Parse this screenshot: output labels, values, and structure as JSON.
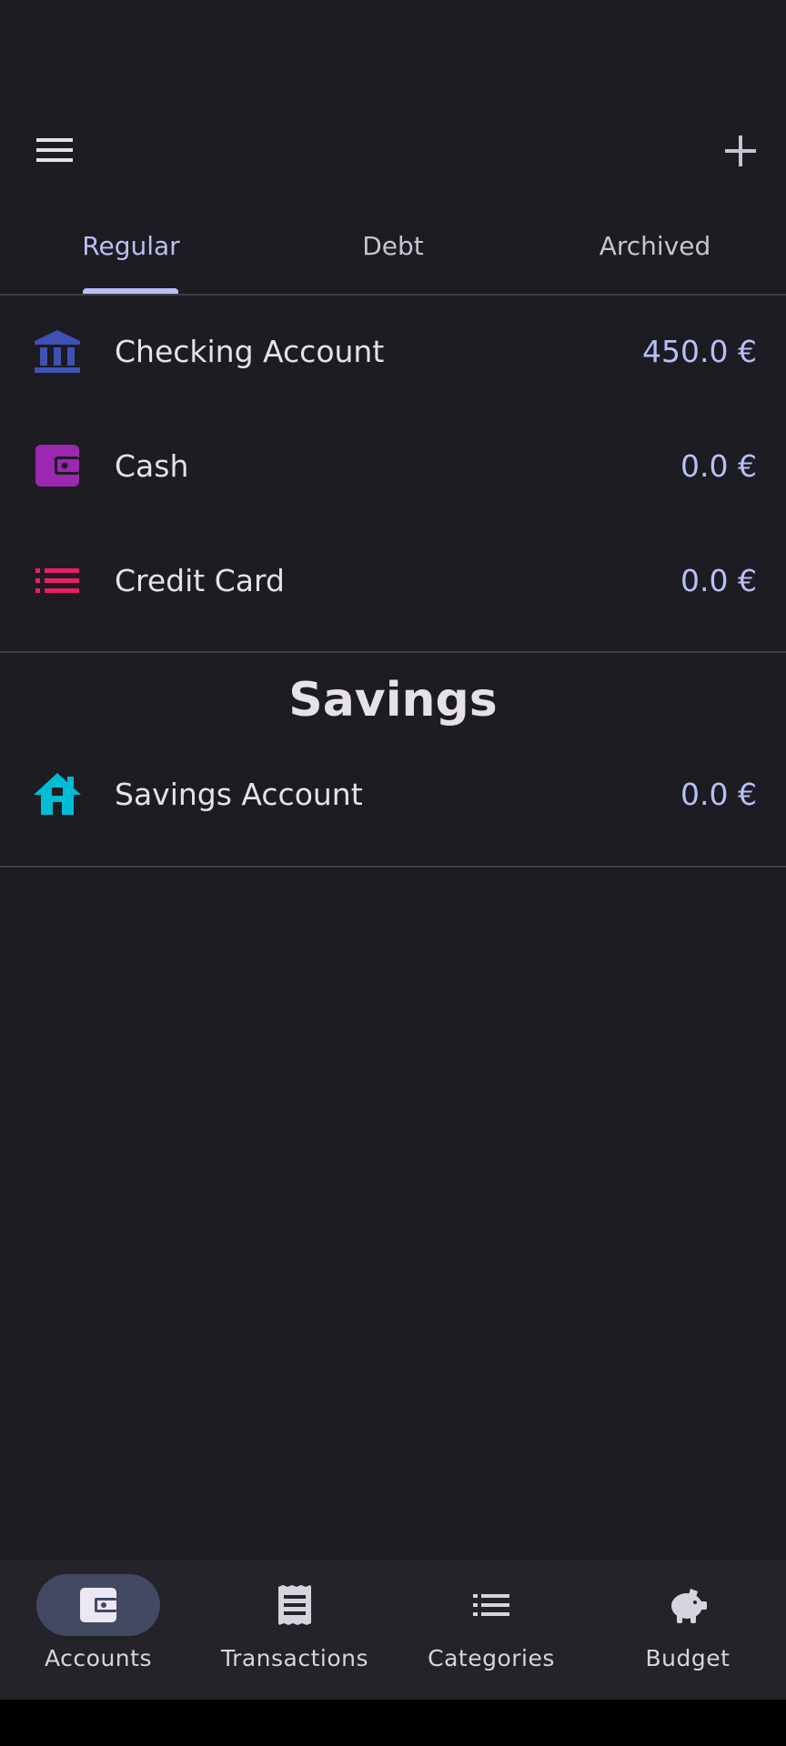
{
  "toolbar": {
    "menu_icon": "menu-icon",
    "add_icon": "plus-icon"
  },
  "tabs": [
    {
      "label": "Regular",
      "active": true
    },
    {
      "label": "Debt",
      "active": false
    },
    {
      "label": "Archived",
      "active": false
    }
  ],
  "regular_accounts": [
    {
      "name": "Checking Account",
      "amount": "450.0 €",
      "icon": "bank-icon",
      "color": "#3f51b5"
    },
    {
      "name": "Cash",
      "amount": "0.0 €",
      "icon": "wallet-icon",
      "color": "#9c27b0"
    },
    {
      "name": "Credit Card",
      "amount": "0.0 €",
      "icon": "list-icon",
      "color": "#e91e63"
    }
  ],
  "savings": {
    "title": "Savings",
    "accounts": [
      {
        "name": "Savings Account",
        "amount": "0.0 €",
        "icon": "home-icon",
        "color": "#00bcd4"
      }
    ]
  },
  "bottom_nav": [
    {
      "label": "Accounts",
      "icon": "wallet-icon",
      "active": true
    },
    {
      "label": "Transactions",
      "icon": "receipt-icon",
      "active": false
    },
    {
      "label": "Categories",
      "icon": "list-icon",
      "active": false
    },
    {
      "label": "Budget",
      "icon": "piggy-bank-icon",
      "active": false
    }
  ]
}
